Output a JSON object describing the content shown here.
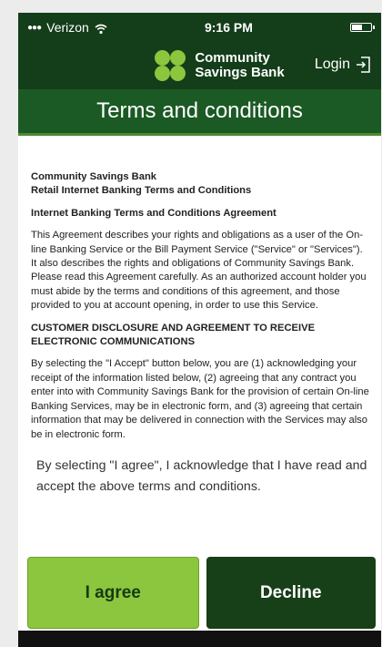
{
  "status": {
    "carrier": "Verizon",
    "time": "9:16 PM"
  },
  "header": {
    "brand_line1": "Community",
    "brand_line2": "Savings Bank",
    "login_label": "Login"
  },
  "title": "Terms and conditions",
  "terms": {
    "bank_name": "Community Savings Bank",
    "doc_title": "Retail Internet Banking Terms and Conditions",
    "agreement_heading": "Internet Banking Terms and Conditions Agreement",
    "paragraph1": "This Agreement describes your rights and obligations as a user of the On-line Banking Service or the Bill Payment Service (\"Service\" or \"Services\"). It also describes the rights and obligations of Community Savings Bank. Please read this Agreement carefully. As an authorized account holder you must abide by the terms and conditions of this agreement, and those provided to you at account opening, in order to use this Service.",
    "disclosure_heading": "CUSTOMER DISCLOSURE AND AGREEMENT TO RECEIVE ELECTRONIC COMMUNICATIONS",
    "paragraph2": "By selecting the \"I Accept\" button below, you are (1) acknowledging your receipt of the information listed below, (2) agreeing that any contract you enter into with Community Savings Bank for the provision of certain On-line Banking Services, may be in electronic form, and (3) agreeing that certain information that may be delivered in connection with the Services may also be in electronic form."
  },
  "acknowledgement": "By selecting \"I agree\", I acknowledge that I have read and accept the above terms and conditions.",
  "buttons": {
    "agree": "I agree",
    "decline": "Decline"
  },
  "colors": {
    "header_green": "#143d1a",
    "title_green": "#1b5a24",
    "accent_lime": "#8cc63f"
  }
}
